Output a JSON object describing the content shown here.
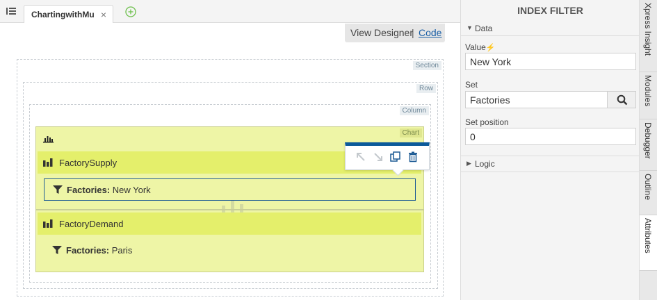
{
  "tabbar": {
    "menu_icon": "list-icon",
    "tab_label": "ChartingwithMu",
    "close_glyph": "×",
    "add_icon": "plus-circle-icon"
  },
  "view_toggle": {
    "designer": "View Designer",
    "separator": "|",
    "code": "Code"
  },
  "layout_tags": {
    "section": "Section",
    "row": "Row",
    "column": "Column",
    "chart": "Chart"
  },
  "chart": {
    "series": [
      {
        "label": "FactorySupply",
        "filter_key": "Factories:",
        "filter_value": " New York"
      },
      {
        "label": "FactoryDemand",
        "filter_key": "Factories:",
        "filter_value": " Paris"
      }
    ]
  },
  "toolbar": {
    "buttons": [
      "move-up-icon",
      "move-down-icon",
      "duplicate-icon",
      "delete-icon"
    ]
  },
  "panel": {
    "title": "INDEX FILTER",
    "data_group": "Data",
    "value_label": "Value",
    "value_bolt": "⚡",
    "value": "New York",
    "set_label": "Set",
    "set_value": "Factories",
    "set_position_label": "Set position",
    "set_position_value": "0",
    "logic_group": "Logic"
  },
  "side_tabs": [
    "Xpress Insight",
    "Modules",
    "Debugger",
    "Outline",
    "Attributes"
  ],
  "colors": {
    "chart_bg": "#eef5a6",
    "series_header_bg": "#e4ef6b",
    "selection_border": "#1c5a94",
    "toolbar_accent": "#0b5a9a",
    "link": "#1a5fa6"
  }
}
